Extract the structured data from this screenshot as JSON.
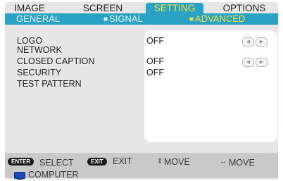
{
  "tabs": [
    {
      "label": "IMAGE"
    },
    {
      "label": "SCREEN"
    },
    {
      "label": "SETTING"
    },
    {
      "label": "OPTIONS"
    }
  ],
  "subtabs": [
    {
      "label": "GENERAL"
    },
    {
      "label": "SIGNAL"
    },
    {
      "label": "ADVANCED"
    }
  ],
  "menu": [
    {
      "label": "LOGO",
      "value": "OFF"
    },
    {
      "label": "NETWORK",
      "value": ""
    },
    {
      "label": "CLOSED CAPTION",
      "value": "OFF"
    },
    {
      "label": "SECURITY",
      "value": "OFF"
    },
    {
      "label": "TEST PATTERN",
      "value": ""
    }
  ],
  "footer": {
    "enter_key": "ENTER",
    "select": "SELECT",
    "exit_key": "EXIT",
    "exit": "EXIT",
    "move_vertical": "MOVE",
    "move_horizontal": "MOVE",
    "source": "COMPUTER"
  },
  "colors": {
    "accent": "#2aa2c6",
    "highlight": "#f7e23a",
    "background": "#e6e6e6"
  }
}
